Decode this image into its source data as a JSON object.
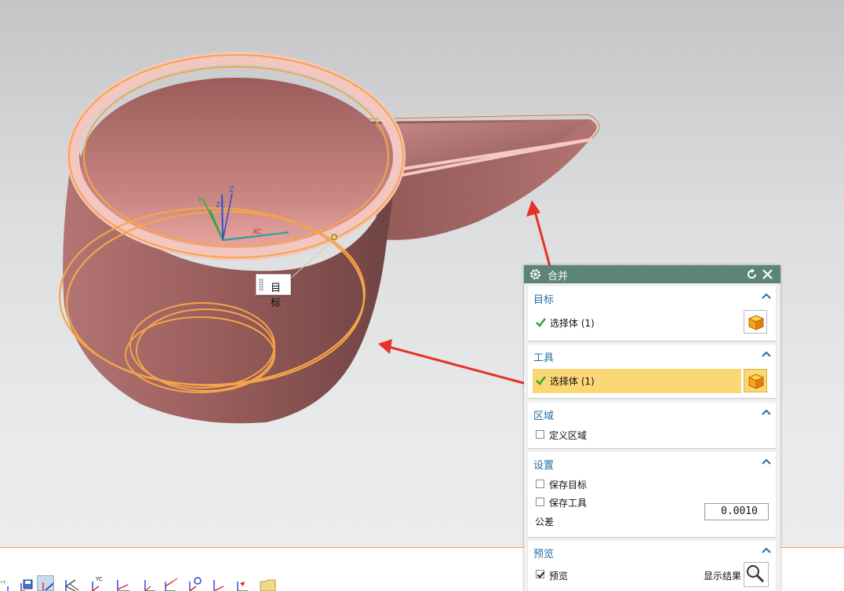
{
  "viewport": {
    "tooltip_text": "目标",
    "triad_labels": {
      "zc": "ZC",
      "xc": "XC",
      "z": "Z",
      "y": "Y"
    }
  },
  "dialog": {
    "title": "合并",
    "sections": {
      "target": {
        "header": "目标",
        "select_label": "选择体 (1)"
      },
      "tool": {
        "header": "工具",
        "select_label": "选择体 (1)"
      },
      "region": {
        "header": "区域",
        "define_region_label": "定义区域",
        "define_region_checked": false
      },
      "settings": {
        "header": "设置",
        "keep_target_label": "保存目标",
        "keep_target_checked": false,
        "keep_tool_label": "保存工具",
        "keep_tool_checked": false,
        "tolerance_label": "公差",
        "tolerance_value": "0.0010"
      },
      "preview": {
        "header": "预览",
        "preview_label": "预览",
        "preview_checked": true,
        "show_result_label": "显示结果"
      }
    }
  },
  "toolbar": {
    "icons": [
      "wcs-orient-icon",
      "save-wcs-icon",
      "wcs-dynamic-icon",
      "wcs-origin-icon",
      "rotate-wcs-icon",
      "wcs-x-icon",
      "wcs-y-icon",
      "wcs-z-icon",
      "wcs-axis-icon",
      "wcs-point-icon",
      "wcs-vector-icon",
      "wcs-mirror-icon",
      "folder-icon"
    ],
    "yc_label": "YC"
  },
  "colors": {
    "accent": "#5c8577",
    "highlight": "#fad774",
    "selection": "#f4a54a",
    "body": "#a86a68",
    "annotation_arrow": "#e8302b"
  }
}
